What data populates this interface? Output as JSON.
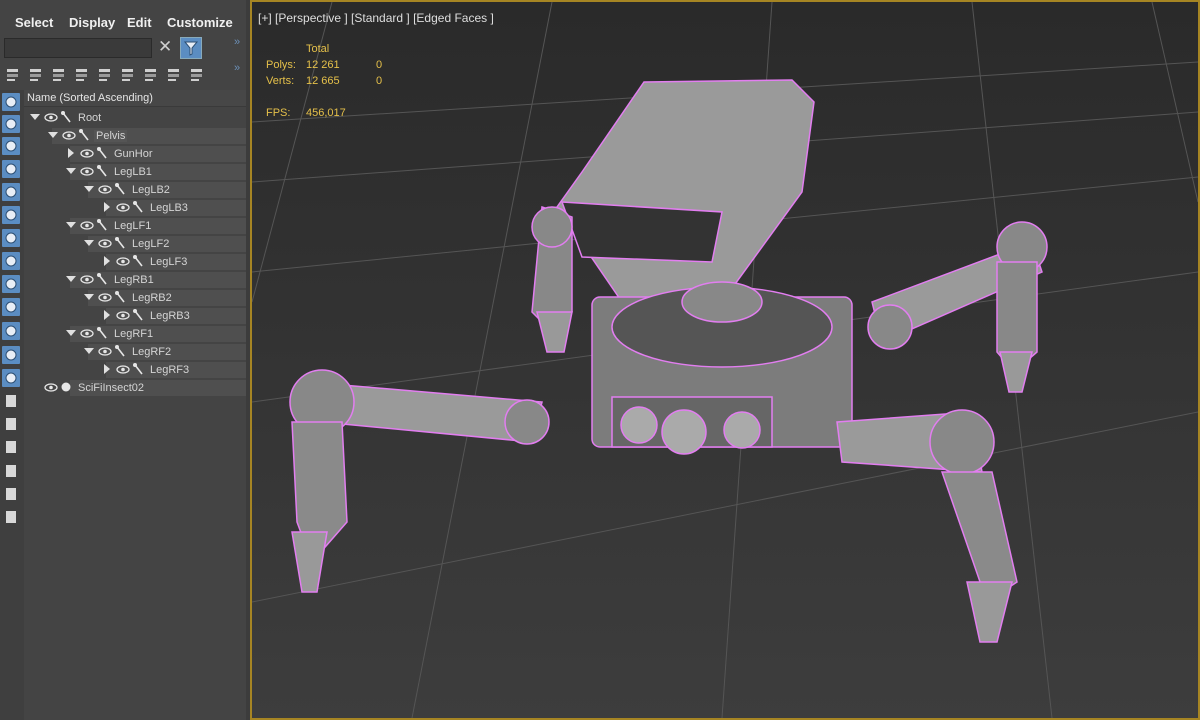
{
  "menu": {
    "items": [
      "Select",
      "Display",
      "Edit",
      "Customize"
    ]
  },
  "search": {
    "value": "",
    "placeholder": ""
  },
  "tree": {
    "header": "Name (Sorted Ascending)",
    "rows": [
      {
        "label": "Root",
        "depth": 0,
        "expanded": true
      },
      {
        "label": "Pelvis",
        "depth": 1,
        "expanded": true
      },
      {
        "label": "GunHor",
        "depth": 2,
        "expanded": false
      },
      {
        "label": "LegLB1",
        "depth": 2,
        "expanded": true
      },
      {
        "label": "LegLB2",
        "depth": 3,
        "expanded": true
      },
      {
        "label": "LegLB3",
        "depth": 4,
        "expanded": false
      },
      {
        "label": "LegLF1",
        "depth": 2,
        "expanded": true
      },
      {
        "label": "LegLF2",
        "depth": 3,
        "expanded": true
      },
      {
        "label": "LegLF3",
        "depth": 4,
        "expanded": false
      },
      {
        "label": "LegRB1",
        "depth": 2,
        "expanded": true
      },
      {
        "label": "LegRB2",
        "depth": 3,
        "expanded": true
      },
      {
        "label": "LegRB3",
        "depth": 4,
        "expanded": false
      },
      {
        "label": "LegRF1",
        "depth": 2,
        "expanded": true
      },
      {
        "label": "LegRF2",
        "depth": 3,
        "expanded": true
      },
      {
        "label": "LegRF3",
        "depth": 4,
        "expanded": false
      },
      {
        "label": "SciFiInsect02",
        "depth": 0,
        "expanded": null
      }
    ]
  },
  "viewport": {
    "label": "[+] [Perspective ] [Standard ] [Edged Faces ]",
    "stats": {
      "total_header": "Total",
      "polys_label": "Polys:",
      "polys_total": "12 261",
      "polys_sel": "0",
      "verts_label": "Verts:",
      "verts_total": "12 665",
      "verts_sel": "0",
      "fps_label": "FPS:",
      "fps_value": "456,017"
    }
  },
  "colors": {
    "accent": "#5b8dc2",
    "viewport_border": "#a68523",
    "stats_text": "#e5c04a",
    "wireframe": "#e27ef0"
  },
  "icons": {
    "toolbar": [
      "display-hierarchy-icon",
      "layer-icon",
      "layer-add-icon",
      "layer-remove-icon",
      "link-icon",
      "unlink-icon",
      "hierarchy-cut-icon",
      "folder-icon",
      "layer-manager-icon"
    ],
    "side": [
      "geometry-filter-icon",
      "shapes-filter-icon",
      "lights-filter-icon",
      "cameras-filter-icon",
      "helpers-filter-icon",
      "spacewarps-filter-icon",
      "groups-filter-icon",
      "xrefs-filter-icon",
      "bones-filter-icon",
      "containers-filter-icon",
      "frozen-filter-icon",
      "particles-filter-icon",
      "hidden-filter-icon",
      "display-all-icon",
      "display-none-icon",
      "display-invert-icon",
      "filter-all-icon",
      "filter-icon",
      "filter-options-icon"
    ]
  }
}
